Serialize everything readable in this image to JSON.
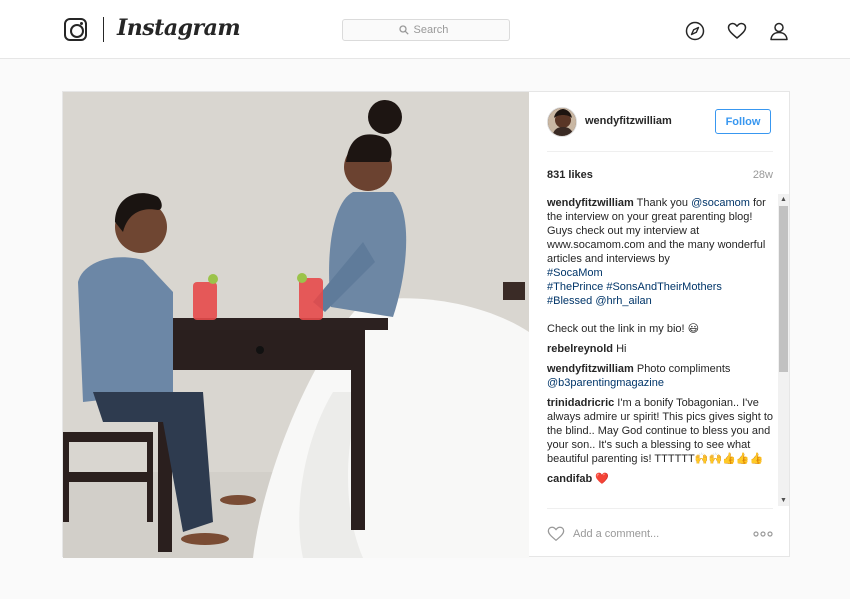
{
  "brand": {
    "wordmark": "Instagram"
  },
  "search": {
    "placeholder": "Search"
  },
  "nav": {
    "icons": [
      "compass-icon",
      "heart-icon",
      "user-icon"
    ]
  },
  "post": {
    "username": "wendyfitzwilliam",
    "follow_label": "Follow",
    "likes": "831 likes",
    "age": "28w",
    "caption": {
      "user": "wendyfitzwilliam",
      "text_1": " Thank you ",
      "mention_1": "@socamom",
      "text_2": " for the interview on your great parenting blog! Guys check out my interview at www.socamom.com and the many wonderful articles and interviews by ",
      "tag_1": "#SocaMom",
      "tag_2": "#ThePrince",
      "tag_3": "#SonsAndTheirMothers",
      "tag_4": "#Blessed",
      "mention_2": "@hrh_ailan",
      "text_3": "Check out the link in my bio! 😃"
    },
    "comments": [
      {
        "user": "rebelreynold",
        "text": " Hi"
      },
      {
        "user": "wendyfitzwilliam",
        "text": " Photo compliments ",
        "mention": "@b3parentingmagazine"
      },
      {
        "user": "trinidadricric",
        "text": " I'm a bonify Tobagonian.. I've always admire ur spirit! This pics gives sight to the blind.. May God continue to bless you and your son.. It's such a blessing to see what beautiful parenting is! TTTTTT🙌🙌👍👍👍"
      },
      {
        "user": "candifab",
        "text": " ❤️"
      }
    ],
    "add_comment_placeholder": "Add a comment..."
  },
  "colors": {
    "accent": "#3897f0",
    "link": "#003569",
    "border": "#e6e6e6"
  }
}
